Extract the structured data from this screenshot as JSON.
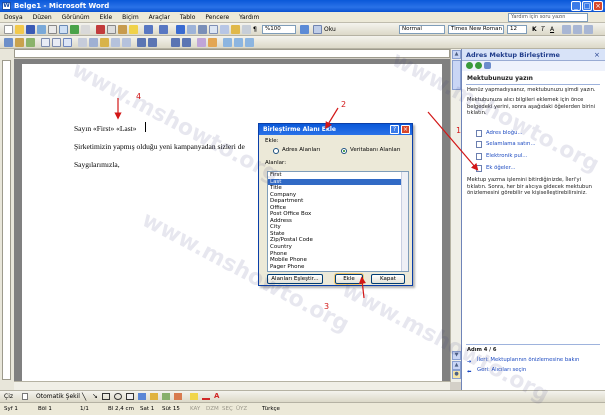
{
  "window": {
    "title": "Belge1 - Microsoft Word",
    "controls": [
      "_",
      "□",
      "×"
    ]
  },
  "menu": {
    "items": [
      "Dosya",
      "Düzen",
      "Görünüm",
      "Ekle",
      "Biçim",
      "Araçlar",
      "Tablo",
      "Pencere",
      "Yardım"
    ],
    "help_placeholder": "Yardım için soru yazın"
  },
  "toolbar": {
    "zoom": "%100",
    "read_label": "Oku",
    "style": "Normal",
    "font": "Times New Roman",
    "size": "12"
  },
  "document": {
    "line1_prefix": "Sayın «First» «Last»",
    "line2": "Şirketimizin yapmış olduğu yeni kampanyadan sizleri de",
    "line3": "Saygılarımızla,"
  },
  "dialog": {
    "title": "Birleştirme Alanı Ekle",
    "ekle_label": "Ekle:",
    "radio_address": "Adres Alanları",
    "radio_db": "Veritabanı Alanları",
    "fields_label": "Alanlar:",
    "fields": [
      "First",
      "Last",
      "Title",
      "Company",
      "Department",
      "Office",
      "Post Office Box",
      "Address",
      "City",
      "State",
      "Zip/Postal Code",
      "Country",
      "Phone",
      "Mobile Phone",
      "Pager Phone"
    ],
    "selected_index": 1,
    "btn_match": "Alanları Eşleştir...",
    "btn_insert": "Ekle",
    "btn_close": "Kapat"
  },
  "taskpane": {
    "title": "Adres Mektup Birleştirme",
    "section_title": "Mektubunuzu yazın",
    "para1": "Henüz yapmadıysanız, mektubunuzu şimdi yazın.",
    "para2": "Mektubunuza alıcı bilgileri eklemek için önce belgedeki yerini, sonra aşağıdaki öğelerden birini tıklatın.",
    "links": [
      "Adres bloğu...",
      "Selamlama satırı...",
      "Elektronik pul...",
      "Ek öğeler..."
    ],
    "para3": "Mektup yazma işlemini bitirdiğinizde, İleri'yi tıklatın. Sonra, her bir alıcıya gidecek mektubun önizlemesini görebilir ve kişiselleştirebilirsiniz.",
    "step": "Adım 4 / 6",
    "next": "İleri: Mektuplarının önizlemesine bakın",
    "back": "Geri: Alıcıları seçin"
  },
  "drawbar": {
    "draw": "Çiz",
    "autoshapes": "Otomatik Şekil"
  },
  "status": {
    "page": "Syf 1",
    "section": "Böl 1",
    "pages": "1/1",
    "at": "Bl 2,4 cm",
    "line": "Sat 1",
    "col": "Süt 15",
    "kay": "KAY",
    "dzm": "DZM",
    "sec": "SEÇ",
    "uyz": "ÜYZ",
    "lang": "Türkçe"
  },
  "annotations": [
    "4",
    "2",
    "1",
    "3"
  ],
  "watermark": "www.mshowto.org",
  "colors": {
    "titlebar": "#0a58d8",
    "selection": "#316ac5",
    "annotation": "#d21717",
    "link": "#1a48c0"
  }
}
